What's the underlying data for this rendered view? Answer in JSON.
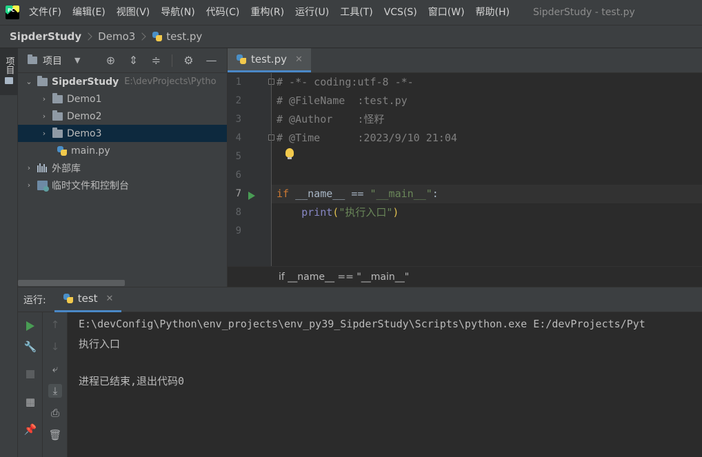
{
  "menubar": {
    "logo_text": "PC",
    "items": [
      "文件(F)",
      "编辑(E)",
      "视图(V)",
      "导航(N)",
      "代码(C)",
      "重构(R)",
      "运行(U)",
      "工具(T)",
      "VCS(S)",
      "窗口(W)",
      "帮助(H)"
    ],
    "window_title": "SipderStudy - test.py"
  },
  "breadcrumb": {
    "project": "SipderStudy",
    "folder": "Demo3",
    "file": "test.py"
  },
  "left_stripe": {
    "project_tab": "项目"
  },
  "project_panel": {
    "title": "项目",
    "tree": [
      {
        "label": "SipderStudy",
        "path": "E:\\devProjects\\Pytho",
        "expanded": true
      },
      {
        "label": "Demo1"
      },
      {
        "label": "Demo2"
      },
      {
        "label": "Demo3",
        "selected": true
      },
      {
        "label": "main.py"
      },
      {
        "label": "外部库"
      },
      {
        "label": "临时文件和控制台"
      }
    ]
  },
  "editor": {
    "tab": "test.py",
    "current_line": 7,
    "line_numbers": [
      "1",
      "2",
      "3",
      "4",
      "5",
      "6",
      "7",
      "8",
      "9"
    ],
    "code": {
      "l1": "# -*- coding:utf-8 -*-",
      "l2": "# @FileName  :test.py",
      "l3": "# @Author    :怪籽",
      "l4": "# @Time      :2023/9/10 21:04",
      "l7_kw": "if",
      "l7_var": " __name__ == ",
      "l7_str": "\"__main__\"",
      "l7_end": ":",
      "l8_indent": "    ",
      "l8_builtin": "print",
      "l8_open": "(",
      "l8_str": "\"执行入口\"",
      "l8_close": ")"
    },
    "breadcrumb": "if __name__ == \"__main__\""
  },
  "run_window": {
    "label": "运行:",
    "tab": "test",
    "console": [
      "E:\\devConfig\\Python\\env_projects\\env_py39_SipderStudy\\Scripts\\python.exe E:/devProjects/Pyt",
      "执行入口",
      "",
      "进程已结束,退出代码0"
    ]
  },
  "colors": {
    "background": "#2b2b2b",
    "panel": "#3c3f41",
    "accent": "#4a88c7",
    "run_green": "#499c54",
    "keyword": "#cc7832",
    "string": "#6a8759",
    "comment": "#808080"
  }
}
